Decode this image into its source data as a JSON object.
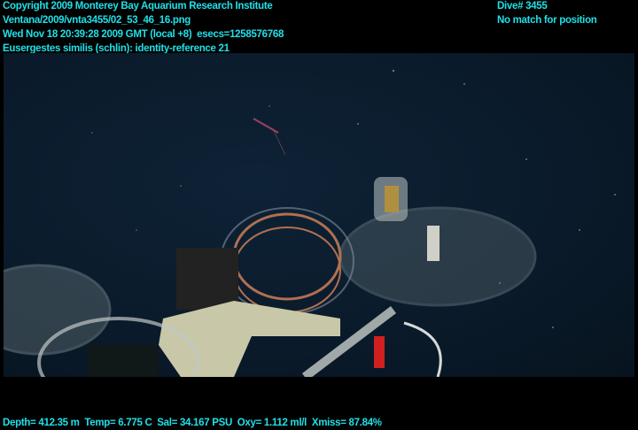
{
  "header": {
    "copyright": "Copyright 2009 Monterey Bay Aquarium Research Institute",
    "file_path": "Ventana/2009/vnta3455/02_53_46_16.png",
    "timestamp": "Wed Nov 18 20:39:28 2009 GMT (local +8)  esecs=1258576768",
    "annotation": "Eusergestes similis (schlin): identity-reference 21",
    "dive": "Dive# 3455",
    "position_status": "No match for position"
  },
  "footer": {
    "sensors": "Depth= 412.35 m  Temp= 6.775 C  Sal= 34.167 PSU  Oxy= 1.112 ml/l  Xmiss= 87.84%"
  },
  "colors": {
    "overlay_text": "#1fe0e8",
    "water": "#0a1a2a"
  }
}
